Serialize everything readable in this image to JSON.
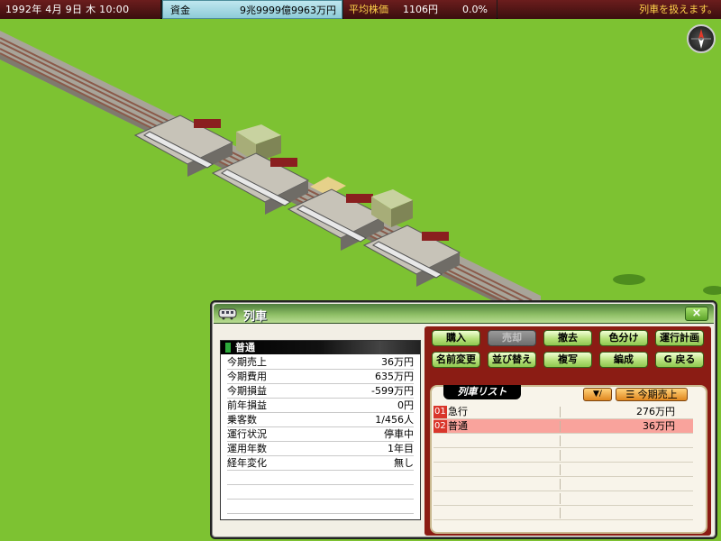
{
  "topbar": {
    "date": "1992年 4月 9日 木  10:00",
    "money_label": "資金",
    "money_value": "9兆9999億9963万円",
    "stock_label": "平均株価",
    "stock_value": "1106円",
    "stock_change": "0.0%",
    "message": "列車を扱えます。"
  },
  "panel": {
    "title": "列車",
    "close_label": "×",
    "info": {
      "title": "普通",
      "rows": [
        {
          "key": "今期売上",
          "value": "36万円"
        },
        {
          "key": "今期費用",
          "value": "635万円"
        },
        {
          "key": "今期損益",
          "value": "-599万円"
        },
        {
          "key": "前年損益",
          "value": "0円"
        },
        {
          "key": "乗客数",
          "value": "1/456人"
        },
        {
          "key": "運行状況",
          "value": "停車中"
        },
        {
          "key": "運用年数",
          "value": "1年目"
        },
        {
          "key": "経年変化",
          "value": "無し"
        }
      ]
    },
    "buttons": {
      "buy": "購入",
      "sell": "売却",
      "remove": "撤去",
      "color": "色分け",
      "schedule": "運行計画",
      "rename": "名前変更",
      "reorder": "並び替え",
      "copy": "複写",
      "formation": "編成",
      "back": "G 戻る"
    },
    "list": {
      "tab_label": "列車リスト",
      "sort_direction": "▼/",
      "sort_key": "☰ 今期売上",
      "items": [
        {
          "num": "01",
          "name": "急行",
          "amount": "276万円",
          "selected": false
        },
        {
          "num": "02",
          "name": "普通",
          "amount": "36万円",
          "selected": true
        }
      ]
    }
  },
  "colors": {
    "grass": "#7dc232",
    "panel_header": "#8cbd64",
    "button_area": "#8b1c14",
    "selected_row": "#f9a39c"
  }
}
